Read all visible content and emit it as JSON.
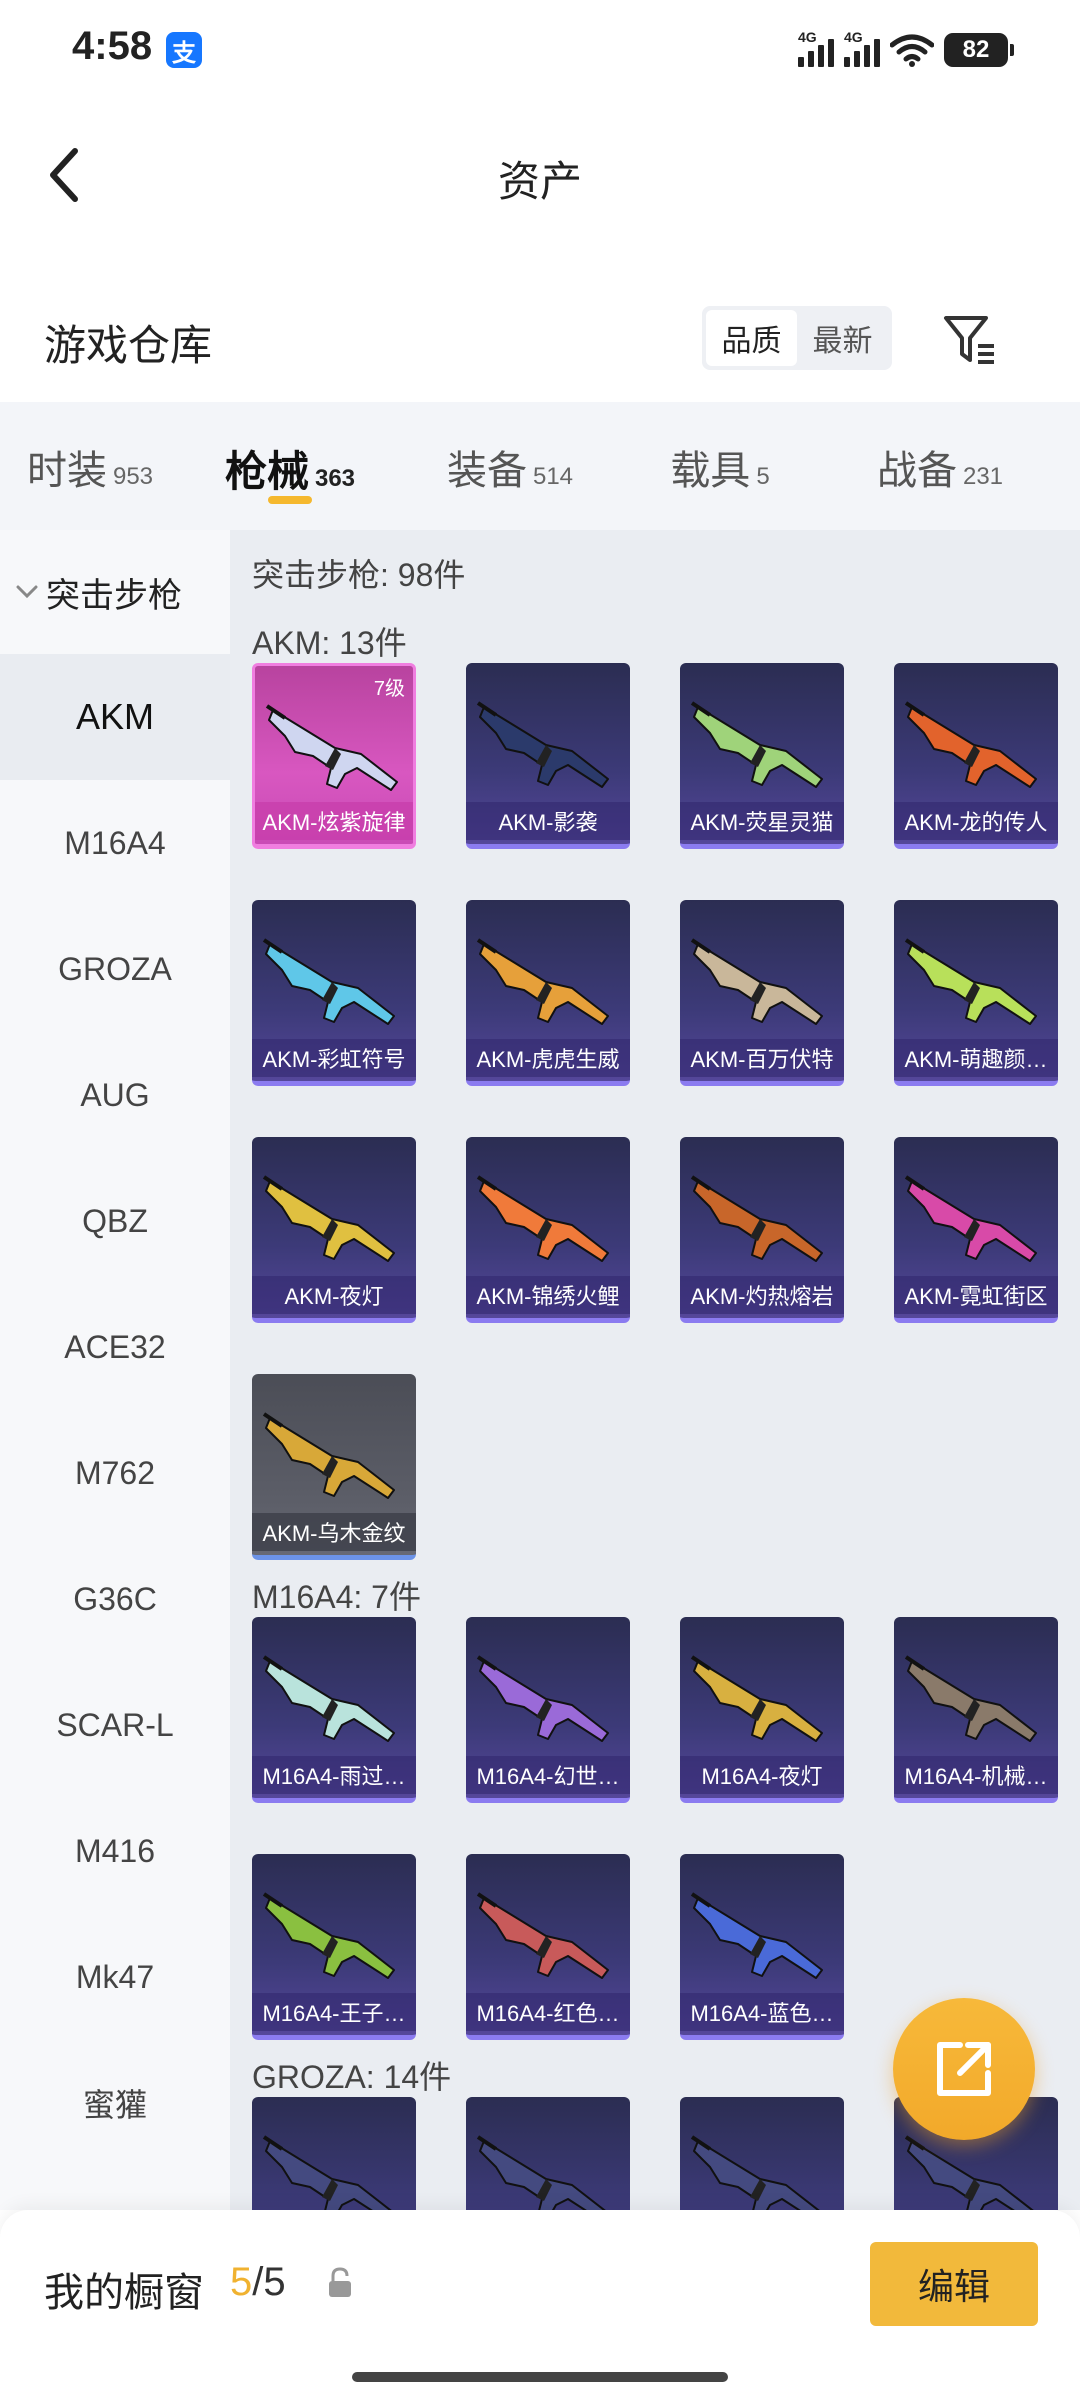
{
  "status_bar": {
    "time": "4:58",
    "app_badge": "支",
    "network_1": "4G",
    "network_2": "4G",
    "battery": "82"
  },
  "header": {
    "title": "资产",
    "back_icon": "chevron-left-icon"
  },
  "warehouse": {
    "title": "游戏仓库",
    "sort_options": [
      "品质",
      "最新"
    ],
    "sort_selected": "品质",
    "filter_icon": "filter-icon"
  },
  "tabs": [
    {
      "label": "时装",
      "count": "953"
    },
    {
      "label": "枪械",
      "count": "363",
      "active": true
    },
    {
      "label": "装备",
      "count": "514"
    },
    {
      "label": "载具",
      "count": "5"
    },
    {
      "label": "战备",
      "count": "231"
    }
  ],
  "sidebar": {
    "group": "突击步枪",
    "items": [
      "AKM",
      "M16A4",
      "GROZA",
      "AUG",
      "QBZ",
      "ACE32",
      "M762",
      "G36C",
      "SCAR-L",
      "M416",
      "Mk47",
      "蜜獾"
    ],
    "active": "AKM"
  },
  "content": {
    "category_heading": "突击步枪: 98件",
    "sections": [
      {
        "heading": "AKM: 13件",
        "items": [
          {
            "name": "AKM-炫紫旋律",
            "level": "7级",
            "rarity": "purple",
            "color": "#cfd6f0"
          },
          {
            "name": "AKM-影袭",
            "rarity": "blue",
            "color": "#2b3a6b"
          },
          {
            "name": "AKM-荧星灵猫",
            "rarity": "blue",
            "color": "#9fd37a"
          },
          {
            "name": "AKM-龙的传人",
            "rarity": "blue",
            "color": "#e2632c"
          },
          {
            "name": "AKM-彩虹符号",
            "rarity": "blue",
            "color": "#5fc7e8"
          },
          {
            "name": "AKM-虎虎生威",
            "rarity": "blue",
            "color": "#e6a03a"
          },
          {
            "name": "AKM-百万伏特",
            "rarity": "blue",
            "color": "#c9b79a"
          },
          {
            "name": "AKM-萌趣颜…",
            "rarity": "blue",
            "color": "#b8e05a"
          },
          {
            "name": "AKM-夜灯",
            "rarity": "blue",
            "color": "#e0c040"
          },
          {
            "name": "AKM-锦绣火鲤",
            "rarity": "blue",
            "color": "#f07a3a"
          },
          {
            "name": "AKM-灼热熔岩",
            "rarity": "blue",
            "color": "#c8662a"
          },
          {
            "name": "AKM-霓虹街区",
            "rarity": "blue",
            "color": "#d84aa8"
          },
          {
            "name": "AKM-乌木金纹",
            "rarity": "gray",
            "color": "#d8a838"
          }
        ]
      },
      {
        "heading": "M16A4: 7件",
        "items": [
          {
            "name": "M16A4-雨过…",
            "rarity": "blue",
            "color": "#b9e3dc"
          },
          {
            "name": "M16A4-幻世…",
            "rarity": "blue",
            "color": "#9a6ad8"
          },
          {
            "name": "M16A4-夜灯",
            "rarity": "blue",
            "color": "#d8b040"
          },
          {
            "name": "M16A4-机械…",
            "rarity": "blue",
            "color": "#8a7a6a"
          },
          {
            "name": "M16A4-王子…",
            "rarity": "blue",
            "color": "#8ac040"
          },
          {
            "name": "M16A4-红色…",
            "rarity": "blue",
            "color": "#c85a5a"
          },
          {
            "name": "M16A4-蓝色…",
            "rarity": "blue",
            "color": "#4a6ad8"
          }
        ]
      },
      {
        "heading": "GROZA: 14件",
        "items": [
          {
            "name": "",
            "rarity": "blue",
            "color": "#444a80"
          },
          {
            "name": "",
            "rarity": "blue",
            "color": "#444a80"
          },
          {
            "name": "",
            "rarity": "blue",
            "color": "#444a80"
          },
          {
            "name": "",
            "rarity": "blue",
            "color": "#444a80"
          }
        ]
      }
    ]
  },
  "fab": {
    "icon": "share-icon"
  },
  "bottom_bar": {
    "label": "我的橱窗",
    "current": "5",
    "separator": "/",
    "total": "5",
    "lock_icon": "lock-icon",
    "edit_label": "编辑"
  },
  "colors": {
    "accent": "#f2b93b",
    "purple_rarity": "#d857c0",
    "blue_rarity": "#8b7bf0"
  }
}
